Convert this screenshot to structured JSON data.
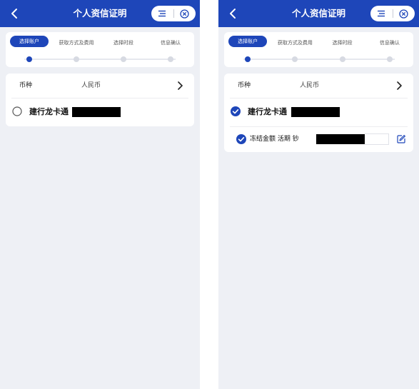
{
  "screens": [
    {
      "title": "个人资信证明",
      "steps": [
        {
          "label": "选择账户",
          "active": true
        },
        {
          "label": "获取方式及费用",
          "active": false
        },
        {
          "label": "选择时段",
          "active": false
        },
        {
          "label": "信息确认",
          "active": false
        }
      ],
      "currency_label": "币种",
      "currency_value": "人民币",
      "account": {
        "name": "建行龙卡通",
        "selected": false
      }
    },
    {
      "title": "个人资信证明",
      "steps": [
        {
          "label": "选择账户",
          "active": true
        },
        {
          "label": "获取方式及费用",
          "active": false
        },
        {
          "label": "选择时段",
          "active": false
        },
        {
          "label": "信息确认",
          "active": false
        }
      ],
      "currency_label": "币种",
      "currency_value": "人民币",
      "account": {
        "name": "建行龙卡通",
        "selected": true
      },
      "sub_account": {
        "label": "冻结金额 活期 钞",
        "selected": true
      }
    }
  ],
  "colors": {
    "primary": "#1e46b9",
    "background": "#eef0f5",
    "inactive_dot": "#d7dae2"
  },
  "icons": {
    "back": "chevron-left-icon",
    "menu": "menu-icon",
    "close": "close-circle-icon",
    "chevron": "chevron-right-icon",
    "radio": "radio-icon",
    "check": "check-circle-icon",
    "edit": "edit-icon"
  }
}
